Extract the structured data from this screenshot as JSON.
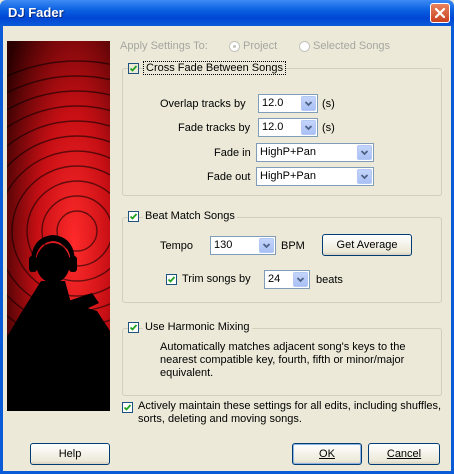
{
  "window": {
    "title": "DJ Fader"
  },
  "apply_settings": {
    "label": "Apply Settings To:",
    "option_project": "Project",
    "option_selected": "Selected Songs",
    "selected": "Project"
  },
  "crossfade": {
    "label": "Cross Fade Between Songs",
    "checked": true,
    "overlap_label": "Overlap tracks by",
    "overlap_value": "12.0",
    "overlap_unit": "(s)",
    "fade_label": "Fade tracks by",
    "fade_value": "12.0",
    "fade_unit": "(s)",
    "fade_in_label": "Fade in",
    "fade_in_value": "HighP+Pan",
    "fade_out_label": "Fade out",
    "fade_out_value": "HighP+Pan"
  },
  "beatmatch": {
    "label": "Beat Match Songs",
    "checked": true,
    "tempo_label": "Tempo",
    "tempo_value": "130",
    "tempo_unit": "BPM",
    "get_average_label": "Get Average",
    "trim_label": "Trim songs by",
    "trim_checked": true,
    "trim_value": "24",
    "trim_unit": "beats"
  },
  "harmonic": {
    "label": "Use Harmonic Mixing",
    "checked": true,
    "description_line1": "Automatically matches adjacent song's keys to the",
    "description_line2": "nearest compatible key, fourth, fifth or minor/major",
    "description_line3": "equivalent."
  },
  "maintain": {
    "checked": true,
    "line1": "Actively maintain these settings for all edits, including shuffles,",
    "line2": "sorts, deleting and moving songs."
  },
  "buttons": {
    "help": "Help",
    "ok": "OK",
    "cancel": "Cancel"
  },
  "colors": {
    "titlebar": "#0a5bd8",
    "dialog_bg": "#ece9d8",
    "art_red": "#d4141c",
    "art_black": "#000000"
  }
}
